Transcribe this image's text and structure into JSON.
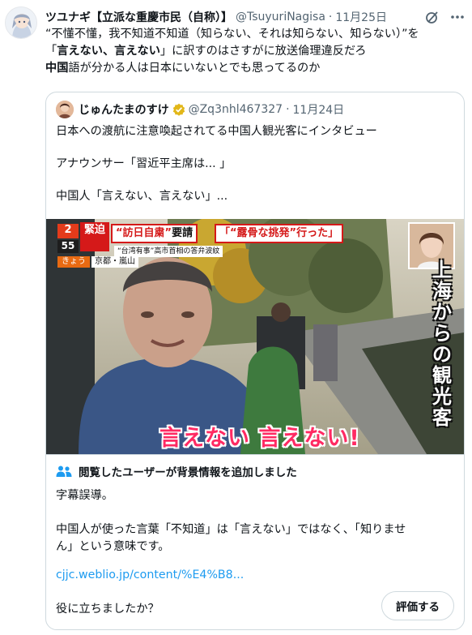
{
  "tweet": {
    "display_name": "ツユナギ【立派な重慶市民（自称）】",
    "handle": "@TsuyuriNagisa",
    "separator": "·",
    "time": "11月25日",
    "text": {
      "line1": "“不懂不懂，我不知道不知道（知らない、それは知らない、知らない）”を",
      "line2_pre": "「",
      "line2_bold": "言えない、言えない",
      "line2_post": "」に訳すのはさすがに放送倫理違反だろ",
      "line3_bold": "中国",
      "line3_post": "語が分かる人は日本にいないとでも思ってるのか"
    }
  },
  "quote": {
    "display_name": "じゅんたまのすけ",
    "handle": "@Zq3nhl467327",
    "separator": "·",
    "time": "11月24日",
    "lines": [
      "日本への渡航に注意喚起されてる中国人観光客にインタビュー",
      "",
      "アナウンサー「習近平主席は... 」",
      "",
      "中国人「言えない、言えない」..."
    ],
    "media": {
      "subtitle": "言えない 言えない!",
      "vertical_caption": "上海からの観光客",
      "tv_badge_top": "緊迫",
      "tv_channel_a": "2",
      "tv_channel_b": "55",
      "tv_headline_red": "“訪日自粛”",
      "tv_headline_rest": "要請",
      "tv_headline2": "「“露骨な挑発”行った」",
      "tv_subline": "“台湾有事”高市首相の答弁波紋",
      "tv_day": "きょう",
      "tv_place": "京都・嵐山"
    }
  },
  "community_note": {
    "heading": "閲覧したユーザーが背景情報を追加しました",
    "body": [
      "字幕誤導。",
      "",
      "中国人が使った言葉「不知道」は「言えない」ではなく、「知りませ",
      "ん」という意味です。"
    ],
    "link": "cjjc.weblio.jp/content/%E4%B8...",
    "question": "役に立ちましたか？",
    "rate_button": "評価する"
  },
  "colors": {
    "text": "#0f1419",
    "secondary": "#536471",
    "link": "#1d9bf0",
    "border": "#cfd9de",
    "subtitle_pink": "#ff2a63",
    "verified_gold": "#e2b719"
  }
}
